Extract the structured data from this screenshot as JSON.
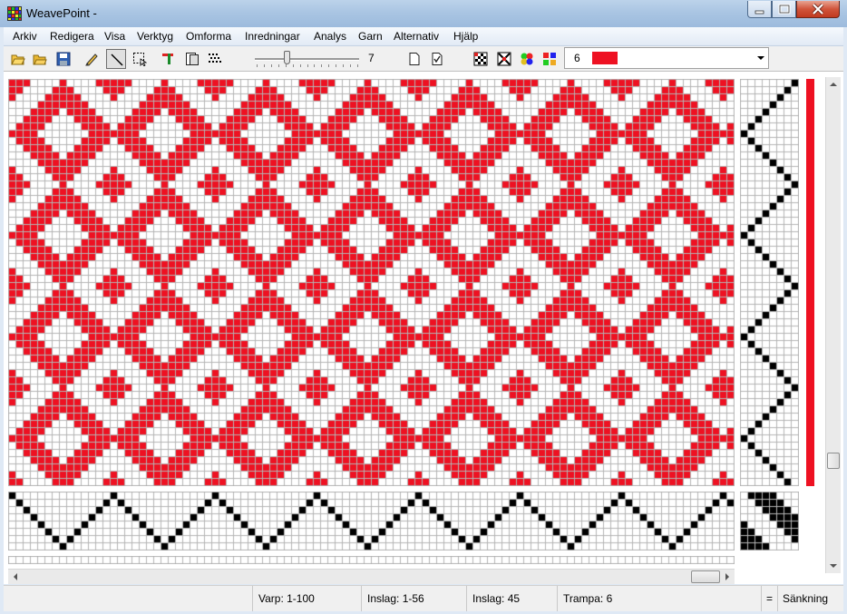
{
  "window": {
    "title": "WeavePoint -"
  },
  "menu": [
    "Arkiv",
    "Redigera",
    "Visa",
    "Verktyg",
    "Omforma",
    "Inredningar",
    "Analys",
    "Garn",
    "Alternativ",
    "Hjälp"
  ],
  "toolbar": {
    "buttons": [
      "open-folder-icon",
      "open-icon",
      "save-icon",
      "pencil-icon",
      "line-icon",
      "selection-icon",
      "threading-icon",
      "layers-icon",
      "dots-icon",
      "new-page-icon",
      "check-page-icon",
      "pattern-icon",
      "cross-pattern-icon",
      "color-balls-icon",
      "color-squares-icon"
    ],
    "zoom_value": "7",
    "zoom_level": 7,
    "color_number": "6",
    "color_swatch": "#ee1122"
  },
  "colors": {
    "red": "#ee1122",
    "grid": "#b5b5b5",
    "black": "#000000"
  },
  "draft": {
    "warp_ends": 100,
    "picks": 56,
    "shafts": 8,
    "treadles": 8
  },
  "status": {
    "warp": "Varp: 1-100",
    "weft": "Inslag: 1-56",
    "current_weft": "Inslag: 45",
    "treadle": "Trampa: 6",
    "equals": "=",
    "mode": "Sänkning"
  }
}
